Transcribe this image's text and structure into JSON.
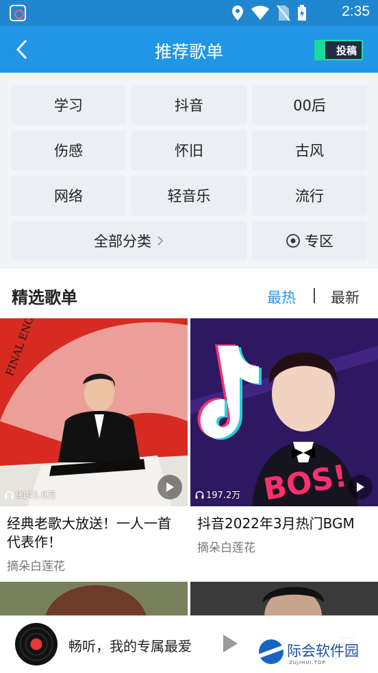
{
  "status_bar": {
    "time": "2:35"
  },
  "app_bar": {
    "title": "推荐歌单",
    "submit_label": "投稿"
  },
  "categories": {
    "items": [
      "学习",
      "抖音",
      "00后",
      "伤感",
      "怀旧",
      "古风",
      "网络",
      "轻音乐",
      "流行"
    ],
    "all_label": "全部分类",
    "zone_label": "专区"
  },
  "featured": {
    "title": "精选歌单",
    "tabs": {
      "hot": "最热",
      "new": "最新"
    },
    "active_tab": "hot",
    "accent_color": "#2796e0"
  },
  "playlists": [
    {
      "plays": "9141.6万",
      "title": "经典老歌大放送！一人一首代表作！",
      "author": "摘朵白莲花"
    },
    {
      "plays": "197.2万",
      "title": "抖音2022年3月热门BGM",
      "author": "摘朵白莲花"
    }
  ],
  "player": {
    "song": "畅听，我的专属最爱"
  },
  "watermark": {
    "text": "际会软件园",
    "sub": "ZUJIHUI.TOP"
  },
  "colors": {
    "app_bar": "#2196e6",
    "status_bar": "#1f86cf"
  }
}
